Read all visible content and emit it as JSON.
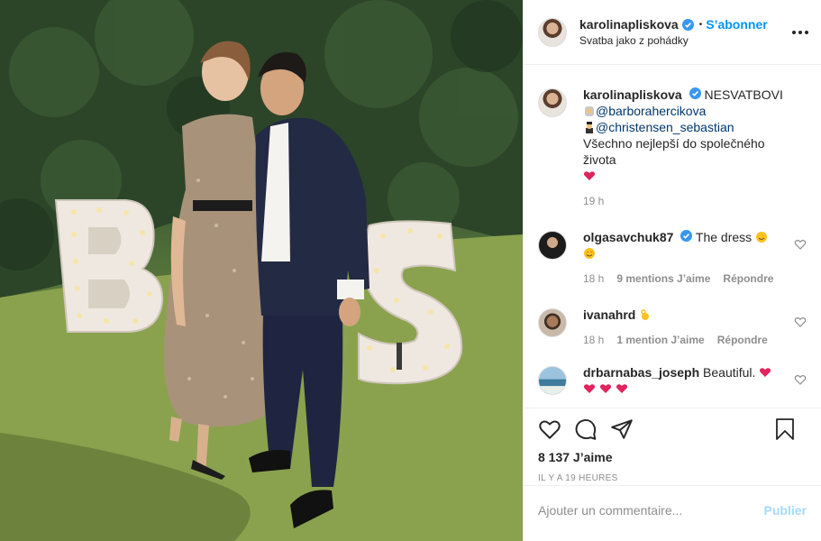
{
  "post": {
    "username": "karolinapliskova",
    "follow_label": "S’abonner",
    "separator": "•",
    "location": "Svatba jako z pohádky",
    "photo_letters": [
      "B",
      "S"
    ]
  },
  "caption": {
    "username": "karolinapliskova",
    "text_intro": "NESVATBOVI",
    "mention1": "@barborahercikova",
    "mention2": "@christensen_sebastian",
    "line3": "Všechno nejlepší do společného života",
    "time": "19 h"
  },
  "comments": [
    {
      "username": "olgasavchuk87",
      "text": "The dress",
      "time": "18 h",
      "likes": "9 mentions J’aime",
      "reply": "Répondre"
    },
    {
      "username": "ivanahrd",
      "text": "",
      "time": "18 h",
      "likes": "1 mention J’aime",
      "reply": "Répondre"
    },
    {
      "username": "drbarnabas_joseph",
      "text": "Beautiful.",
      "time": "",
      "likes": "",
      "reply": ""
    }
  ],
  "actions": {
    "likes_count": "8 137 J’aime",
    "time_ago": "IL Y A 19 HEURES",
    "comment_placeholder": "Ajouter un commentaire...",
    "publish_label": "Publier"
  },
  "icons": [
    "verified-badge",
    "more-options",
    "heart",
    "comment",
    "share",
    "save-bookmark"
  ],
  "colors": {
    "link_blue": "#0095f6",
    "mention": "#00376b",
    "muted": "#8e8e8e",
    "heart_red": "#e0245e"
  }
}
